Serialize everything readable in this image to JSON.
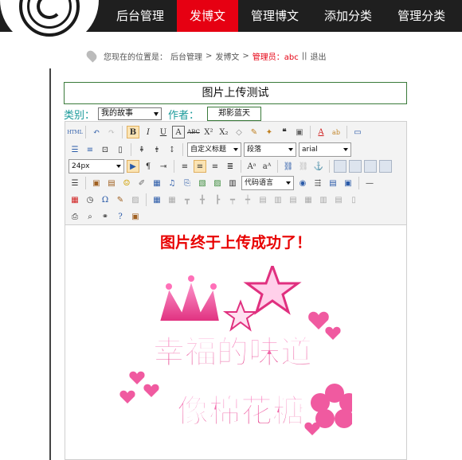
{
  "nav": {
    "items": [
      {
        "label": "后台管理",
        "active": false
      },
      {
        "label": "发博文",
        "active": true
      },
      {
        "label": "管理博文",
        "active": false
      },
      {
        "label": "添加分类",
        "active": false
      },
      {
        "label": "管理分类",
        "active": false
      }
    ],
    "active_color": "#e60012"
  },
  "breadcrumb": {
    "prefix": "您现在的位置是：",
    "path1": "后台管理",
    "sep": ">",
    "path2": "发博文",
    "user_label": "管理员：abc",
    "divider": "||",
    "logout": "退出"
  },
  "form": {
    "title_value": "图片上传测试",
    "category_label": "类别：",
    "category_value": "我的故事",
    "author_label": "作者：",
    "author_value": "郑影蓝天"
  },
  "editor": {
    "format_select": "自定义标题",
    "paragraph_select": "段落",
    "font_select": "arial",
    "size_select": "24px",
    "code_select": "代码语言",
    "content_heading": "图片终于上传成功了！",
    "image_text_line1": "幸福的味道",
    "image_text_line2": "像棉花糖"
  }
}
